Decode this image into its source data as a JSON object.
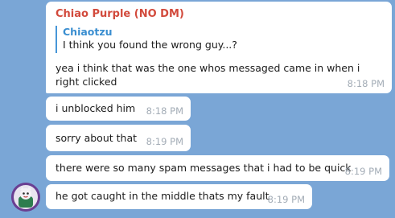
{
  "chat": {
    "messages": [
      {
        "sender": "Chiao Purple (NO DM)",
        "sender_color": "#d24a3c",
        "reply_to": {
          "name": "Chiaotzu",
          "text": "I think you found the wrong guy...?"
        },
        "text": "yea i think that was the one whos messaged came in when i right clicked",
        "time": "8:18 PM"
      },
      {
        "text": "i unblocked him",
        "time": "8:18 PM"
      },
      {
        "text": "sorry about that",
        "time": "8:19 PM"
      },
      {
        "text": "there were so many spam messages that i had to be quick",
        "time": "8:19 PM"
      },
      {
        "text": "he got caught in the middle thats my fault",
        "time": "8:19 PM"
      }
    ],
    "avatar_icon": "purple-character-avatar"
  },
  "colors": {
    "background": "#7aa6d6",
    "bubble": "#ffffff",
    "reply_accent": "#4796d8"
  }
}
